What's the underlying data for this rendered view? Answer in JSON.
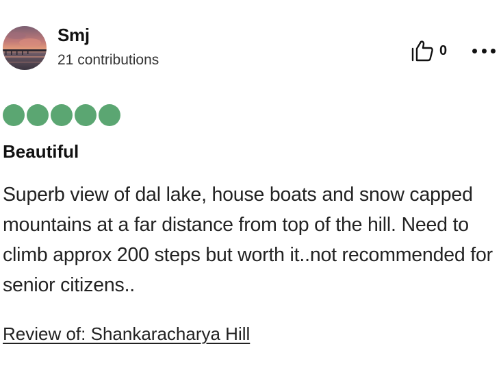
{
  "reviewer": {
    "name": "Smj",
    "contributions": "21 contributions",
    "avatar_icon": "avatar-sunset-pier"
  },
  "actions": {
    "like_icon": "thumbs-up-icon",
    "like_count": "0",
    "more_icon": "more-options-icon"
  },
  "rating": {
    "value": 5,
    "max": 5,
    "color": "#5ba672"
  },
  "review": {
    "title": "Beautiful",
    "body": "Superb view of dal lake, house boats and snow capped mountains at a far distance from top of the hill. Need to climb approx 200 steps but worth it..not recommended for senior citizens..",
    "review_of": "Review of: Shankaracharya Hill"
  }
}
